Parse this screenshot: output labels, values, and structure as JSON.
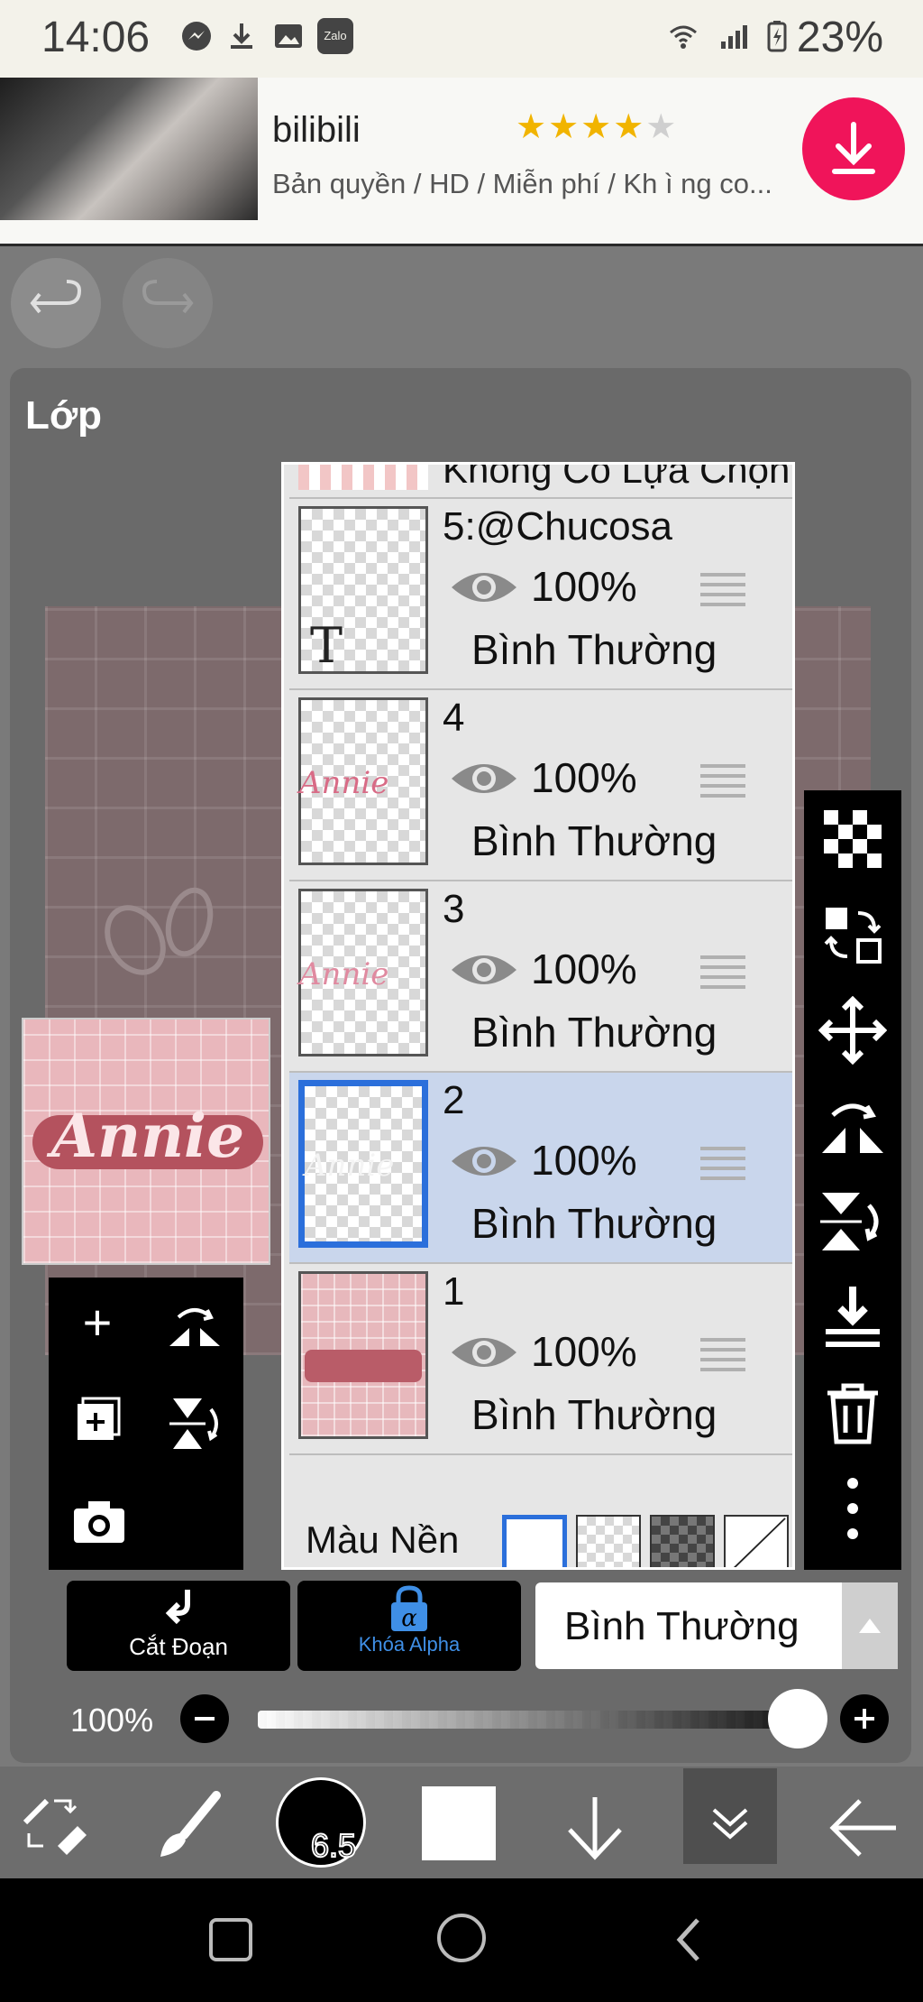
{
  "status_bar": {
    "time": "14:06",
    "battery": "23%"
  },
  "ad": {
    "title": "bilibili",
    "stars": "★★★★★",
    "subtitle": "Bản quyền / HD / Miễn phí / Kh ì ng co...",
    "colors": {
      "accent": "#f0145a",
      "star": "#f1b400"
    }
  },
  "panel": {
    "title": "Lớp"
  },
  "layers": {
    "top_partial": "Không Có Lựa Chọn",
    "items": [
      {
        "name": "5:@Chucosa",
        "opacity": "100%",
        "mode": "Bình Thường",
        "thumb_text": "T"
      },
      {
        "name": "4",
        "opacity": "100%",
        "mode": "Bình Thường",
        "thumb_text": "Annie"
      },
      {
        "name": "3",
        "opacity": "100%",
        "mode": "Bình Thường",
        "thumb_text": "Annie"
      },
      {
        "name": "2",
        "opacity": "100%",
        "mode": "Bình Thường",
        "thumb_text": "Annie"
      },
      {
        "name": "1",
        "opacity": "100%",
        "mode": "Bình Thường"
      }
    ],
    "bg_label": "Màu Nền"
  },
  "preview": {
    "text": "Annie"
  },
  "bottom": {
    "cut_label": "Cắt Đoạn",
    "alpha_label": "Khóa Alpha",
    "blend_mode": "Bình Thường",
    "opacity": "100%",
    "opacity_value": 1.0,
    "brush_size": "6.5"
  },
  "colors": {
    "selected_layer": "#c9d6ec",
    "selection_border": "#2b6fdb",
    "alpha_text": "#3f8fe6"
  }
}
